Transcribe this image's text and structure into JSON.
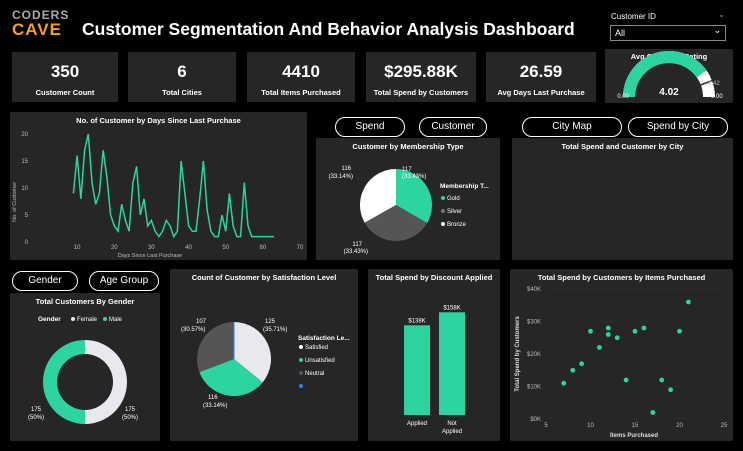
{
  "header": {
    "logo_top": "CODERS",
    "logo_bottom": "CAVE",
    "title": "Customer Segmentation And Behavior Analysis Dashboard",
    "filter_label": "Customer ID",
    "filter_value": "All"
  },
  "kpis": [
    {
      "value": "350",
      "label": "Customer Count"
    },
    {
      "value": "6",
      "label": "Total Cities"
    },
    {
      "value": "4410",
      "label": "Total Items Purchased"
    },
    {
      "value": "$295.88K",
      "label": "Total Spend by Customers"
    },
    {
      "value": "26.59",
      "label": "Avg Days Last Purchase"
    }
  ],
  "gauge": {
    "title": "Avg Customer Rating",
    "value": "4.02",
    "min": "0.00",
    "max": "5.00",
    "target": "4.42",
    "fraction": 0.804,
    "color": "#2bd4a0"
  },
  "buttons": {
    "spend": "Spend",
    "customer": "Customer",
    "city_map": "City Map",
    "spend_by_city": "Spend by City",
    "gender": "Gender",
    "age_group": "Age Group"
  },
  "line_chart": {
    "title": "No. of Customer by Days Since Last Purchase",
    "xlabel": "Days Since Last Purchase",
    "ylabel": "No. of Customer",
    "x_ticks": [
      "10",
      "20",
      "30",
      "40",
      "50",
      "60",
      "70"
    ],
    "y_ticks": [
      "0",
      "5",
      "10",
      "15",
      "20"
    ]
  },
  "membership": {
    "title": "Customer by Membership Type",
    "legend_title": "Membership T...",
    "labels": [
      "117",
      "(33.43%)",
      "117",
      "(33.43%)",
      "116",
      "(33.14%)"
    ],
    "legend": [
      "Gold",
      "Silver",
      "Bronze"
    ]
  },
  "city": {
    "title": "Total Spend and Customer by City"
  },
  "gender": {
    "title": "Total Customers By Gender",
    "legend_title": "Gender",
    "legend": [
      "Female",
      "Male"
    ],
    "left_label": "175",
    "left_pct": "(50%)",
    "right_label": "175",
    "right_pct": "(50%)"
  },
  "satisfaction": {
    "title": "Count of Customer by Satisfaction Level",
    "legend_title": "Satisfaction Le...",
    "legend": [
      "Satisfied",
      "Unsatisfied",
      "Neutral"
    ],
    "lbl_a": "107",
    "lbl_a_pct": "(30.57%)",
    "lbl_b": "125",
    "lbl_b_pct": "(35.71%)",
    "lbl_c": "116",
    "lbl_c_pct": "(33.14%)"
  },
  "discount": {
    "title": "Total Spend by Discount Applied",
    "bars": [
      {
        "label": "$138K",
        "cat": "Applied",
        "value": 138
      },
      {
        "label": "$158K",
        "cat": "Not Applied",
        "value": 158
      }
    ],
    "cat2_line2": "Applied"
  },
  "scatter": {
    "title": "Total Spend by Customers by Items Purchased",
    "xlabel": "Items Purchased",
    "ylabel": "Total Spend by Customers",
    "x_ticks": [
      "5",
      "10",
      "15",
      "20",
      "25"
    ],
    "y_ticks": [
      "$0K",
      "$10K",
      "$20K",
      "$30K",
      "$40K"
    ]
  },
  "chart_data": [
    {
      "type": "line",
      "title": "No. of Customer by Days Since Last Purchase",
      "xlabel": "Days Since Last Purchase",
      "ylabel": "No. of Customer",
      "xlim": [
        0,
        70
      ],
      "ylim": [
        0,
        20
      ],
      "x": [
        9,
        10,
        11,
        12,
        13,
        14,
        15,
        16,
        17,
        18,
        19,
        20,
        21,
        22,
        23,
        24,
        25,
        26,
        27,
        28,
        29,
        30,
        31,
        32,
        33,
        34,
        35,
        36,
        37,
        38,
        39,
        40,
        41,
        42,
        43,
        44,
        45,
        46,
        47,
        48,
        49,
        50,
        51,
        52,
        53,
        54,
        55,
        56,
        57,
        58,
        59,
        60,
        61,
        62,
        63
      ],
      "y": [
        9,
        16,
        8,
        17,
        20,
        11,
        7,
        9,
        17,
        12,
        5,
        3,
        2,
        7,
        4,
        2,
        11,
        14,
        5,
        8,
        3,
        4,
        2,
        1,
        2,
        4,
        3,
        1,
        2,
        15,
        9,
        3,
        2,
        2,
        8,
        15,
        6,
        2,
        1,
        1,
        5,
        2,
        9,
        3,
        1,
        1,
        11,
        3,
        1,
        1,
        1,
        1,
        1,
        1,
        1
      ],
      "color": "#2bd4a0"
    },
    {
      "type": "pie",
      "title": "Customer by Membership Type",
      "categories": [
        "Gold",
        "Silver",
        "Bronze"
      ],
      "values": [
        117,
        117,
        116
      ],
      "colors": [
        "#2bd4a0",
        "#555555",
        "#ffffff"
      ]
    },
    {
      "type": "pie",
      "title": "Total Customers By Gender",
      "categories": [
        "Female",
        "Male"
      ],
      "values": [
        175,
        175
      ],
      "colors": [
        "#e8e8ee",
        "#2bd4a0"
      ]
    },
    {
      "type": "pie",
      "title": "Count of Customer by Satisfaction Level",
      "categories": [
        "Satisfied",
        "Unsatisfied",
        "Neutral"
      ],
      "values": [
        125,
        116,
        107
      ],
      "colors": [
        "#e8e8ee",
        "#2bd4a0",
        "#555555"
      ]
    },
    {
      "type": "bar",
      "title": "Total Spend by Discount Applied",
      "categories": [
        "Applied",
        "Not Applied"
      ],
      "values": [
        138,
        158
      ],
      "color": "#2bd4a0"
    },
    {
      "type": "scatter",
      "title": "Total Spend by Customers by Items Purchased",
      "xlabel": "Items Purchased",
      "ylabel": "Total Spend by Customers",
      "xlim": [
        5,
        25
      ],
      "ylim": [
        0,
        40
      ],
      "points": [
        [
          7,
          11
        ],
        [
          8,
          15
        ],
        [
          9,
          17
        ],
        [
          10,
          27
        ],
        [
          11,
          22
        ],
        [
          12,
          26
        ],
        [
          12,
          28
        ],
        [
          13,
          25
        ],
        [
          14,
          12
        ],
        [
          15,
          27
        ],
        [
          16,
          28
        ],
        [
          17,
          2
        ],
        [
          18,
          12
        ],
        [
          19,
          9
        ],
        [
          20,
          27
        ],
        [
          21,
          36
        ]
      ],
      "color": "#2bd4a0"
    }
  ]
}
